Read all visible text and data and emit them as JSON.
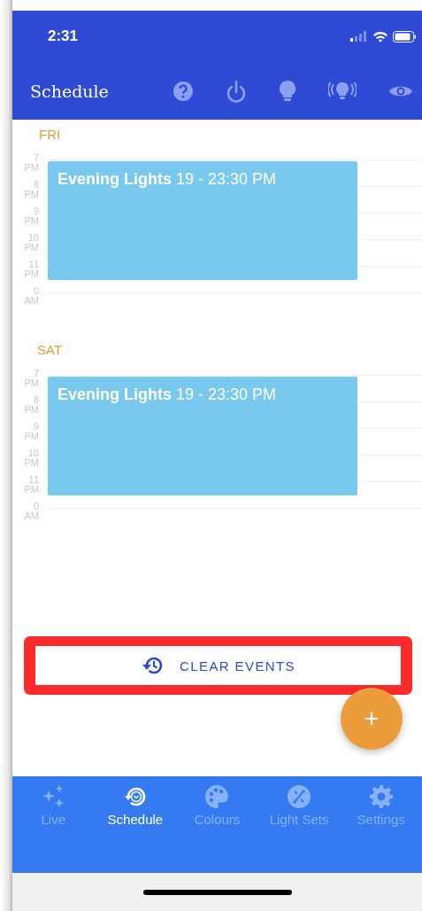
{
  "status_bar": {
    "time": "2:31"
  },
  "header": {
    "title": "Schedule"
  },
  "days": [
    {
      "label": "FRI",
      "hours": [
        {
          "hour": "7",
          "period": "PM"
        },
        {
          "hour": "8",
          "period": "PM"
        },
        {
          "hour": "9",
          "period": "PM"
        },
        {
          "hour": "10",
          "period": "PM"
        },
        {
          "hour": "11",
          "period": "PM"
        },
        {
          "hour": "0",
          "period": "AM"
        }
      ],
      "events": [
        {
          "title": "Evening Lights",
          "time": "19 - 23:30 PM"
        }
      ]
    },
    {
      "label": "SAT",
      "hours": [
        {
          "hour": "7",
          "period": "PM"
        },
        {
          "hour": "8",
          "period": "PM"
        },
        {
          "hour": "9",
          "period": "PM"
        },
        {
          "hour": "10",
          "period": "PM"
        },
        {
          "hour": "11",
          "period": "PM"
        },
        {
          "hour": "0",
          "period": "AM"
        }
      ],
      "events": [
        {
          "title": "Evening Lights",
          "time": "19 - 23:30 PM"
        }
      ]
    }
  ],
  "clear_button": {
    "label": "CLEAR EVENTS",
    "highlighted": true
  },
  "fab": {
    "label": "+"
  },
  "tabs": [
    {
      "label": "Live",
      "kind": "stars",
      "selected": false
    },
    {
      "label": "Schedule",
      "kind": "clock",
      "selected": true
    },
    {
      "label": "Colours",
      "kind": "palette",
      "selected": false
    },
    {
      "label": "Light Sets",
      "kind": "link",
      "selected": false
    },
    {
      "label": "Settings",
      "kind": "gear",
      "selected": false
    }
  ]
}
